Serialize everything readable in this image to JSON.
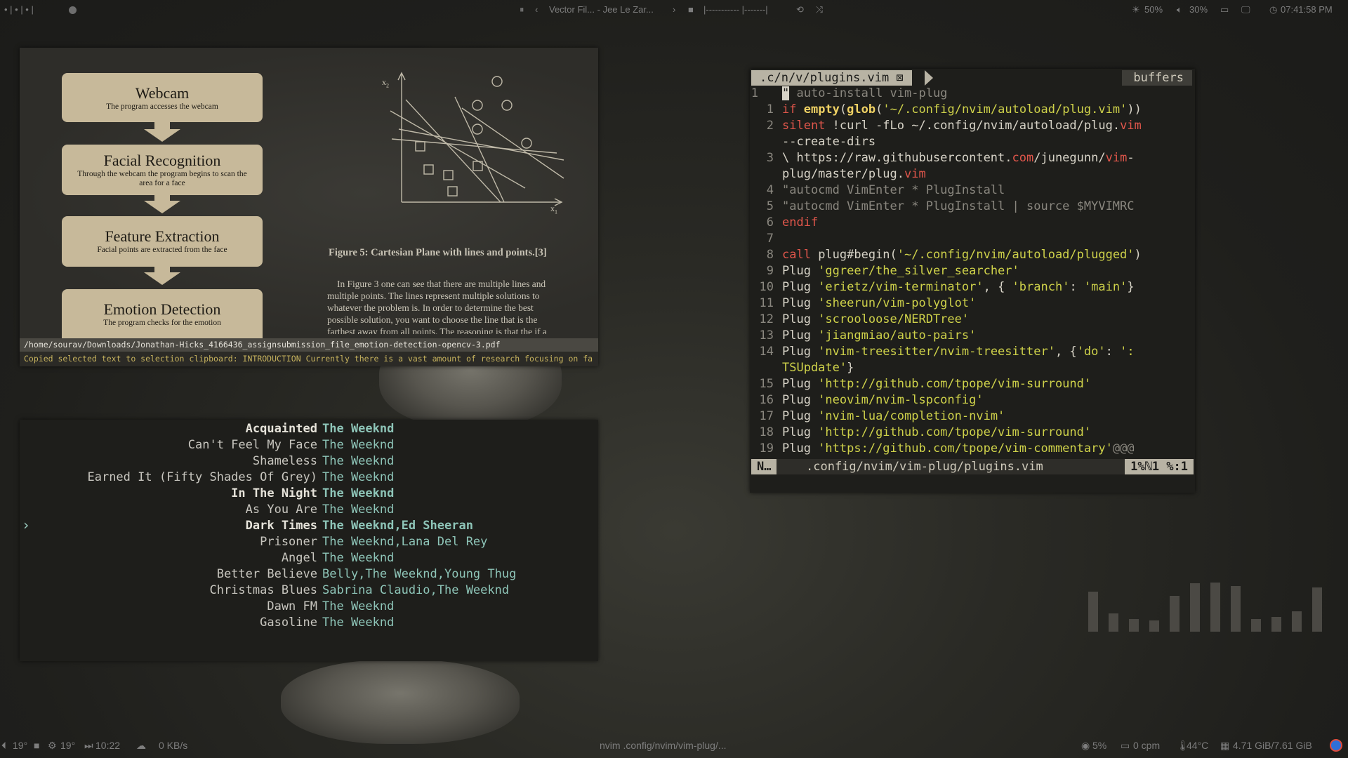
{
  "topbar": {
    "workspaces": "• | • | • |",
    "media_title": "Vector Fil... - Jee Le Zar...",
    "progress": "|----------- |-------|",
    "brightness": "50%",
    "volume": "30%",
    "clock": "07:41:58 PM"
  },
  "pdf": {
    "flow": [
      {
        "title": "Webcam",
        "sub": "The program accesses the webcam"
      },
      {
        "title": "Facial Recognition",
        "sub": "Through the webcam the program begins to scan the area for a face"
      },
      {
        "title": "Feature Extraction",
        "sub": "Facial points are extracted from the face"
      },
      {
        "title": "Emotion Detection",
        "sub": "The program checks for the emotion"
      }
    ],
    "axis_x": "x",
    "axis_x_sub": "1",
    "axis_y": "x",
    "axis_y_sub": "2",
    "caption": "Figure 5: Cartesian Plane with lines and points.[3]",
    "paragraph": [
      "In Figure 3 one can see that there are multiple lines and",
      "multiple points.  The lines represent multiple solutions to",
      "whatever the problem is.  In order to determine the best",
      "possible solution, you want to choose the line that is the",
      "farthest away from all points. The reasoning is that the if a"
    ],
    "path": "/home/sourav/Downloads/Jonathan-Hicks_4166436_assignsubmission_file_emotion-detection-opencv-3.pdf",
    "message": "Copied selected text to selection clipboard: INTRODUCTION Currently there is a vast amount of research focusing on fa"
  },
  "music": {
    "rows": [
      {
        "song": "Acquainted",
        "artist": "The Weeknd",
        "bold": true
      },
      {
        "song": "Can't Feel My Face",
        "artist": "The Weeknd",
        "bold": false
      },
      {
        "song": "Shameless",
        "artist": "The Weeknd",
        "bold": false
      },
      {
        "song": "Earned It (Fifty Shades Of Grey)",
        "artist": "The Weeknd",
        "bold": false
      },
      {
        "song": "In The Night",
        "artist": "The Weeknd",
        "bold": true
      },
      {
        "song": "As You Are",
        "artist": "The Weeknd",
        "bold": false
      },
      {
        "song": "Dark Times",
        "artist": "The Weeknd,Ed Sheeran",
        "bold": true
      },
      {
        "song": "Prisoner",
        "artist": "The Weeknd,Lana Del Rey",
        "bold": false
      },
      {
        "song": "Angel",
        "artist": "The Weeknd",
        "bold": false
      },
      {
        "song": "Better Believe",
        "artist": "Belly,The Weeknd,Young Thug",
        "bold": false
      },
      {
        "song": "Christmas Blues",
        "artist": "Sabrina Claudio,The Weeknd",
        "bold": false
      },
      {
        "song": "Dawn FM",
        "artist": "The Weeknd",
        "bold": false
      },
      {
        "song": "Gasoline",
        "artist": "The Weeknd",
        "bold": false
      }
    ],
    "cursor": "›"
  },
  "vim": {
    "tab": ".c/n/v/plugins.vim ⊠",
    "buffers": "buffers",
    "mode": "N…",
    "file": ".config/nvim/vim-plug/plugins.vim",
    "position": "1%ℕ1 %:1"
  },
  "visualizer": {
    "levels": [
      0.65,
      0.3,
      0.2,
      0.18,
      0.58,
      0.78,
      0.8,
      0.74,
      0.2,
      0.24,
      0.33,
      0.72
    ]
  },
  "botbar": {
    "temp1": "19°",
    "temp2": "19°",
    "time": "10:22",
    "net": "0 KB/s",
    "window_title": "nvim .config/nvim/vim-plug/...",
    "cpu": "5%",
    "cpm": "0 cpm",
    "cpu_temp": "44°C",
    "memory": "4.71 GiB/7.61 GiB"
  }
}
